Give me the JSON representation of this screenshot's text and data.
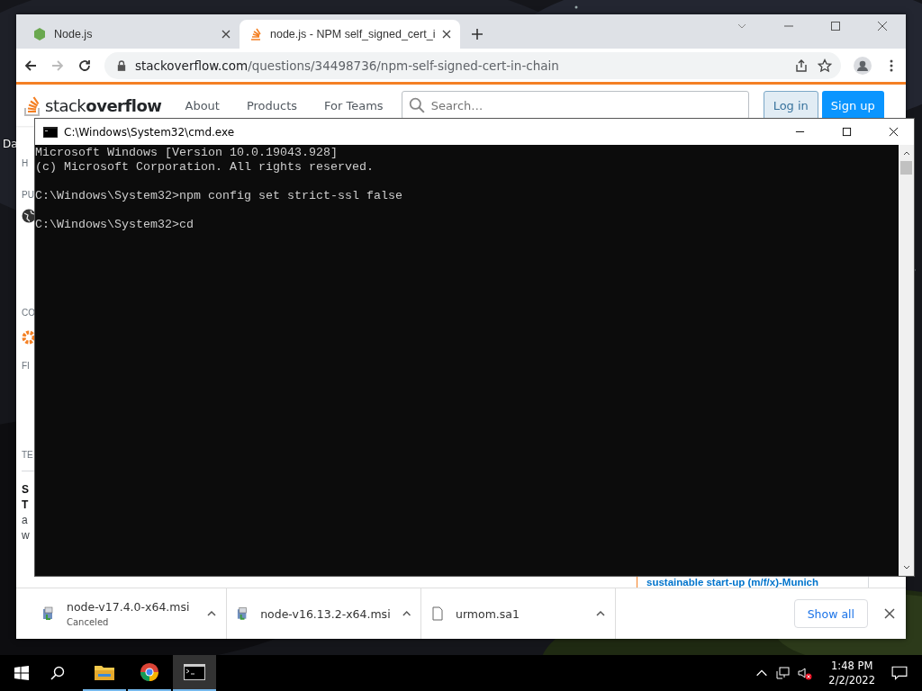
{
  "desktop": {
    "icon_label": "Da"
  },
  "browser": {
    "tabs": [
      {
        "title": "Node.js",
        "selected": false
      },
      {
        "title": "node.js - NPM self_signed_cert_i",
        "selected": true
      }
    ],
    "url_host": "stackoverflow.com",
    "url_path": "/questions/34498736/npm-self-signed-cert-in-chain",
    "page": {
      "logo": "stack**overflow**",
      "nav": [
        "About",
        "Products",
        "For Teams"
      ],
      "search_placeholder": "Search…",
      "login": "Log in",
      "signup": "Sign up",
      "sidebar_labels": [
        "H",
        "PU",
        "CO",
        "FI",
        "TE"
      ],
      "card_lines": [
        "S",
        "T",
        "a",
        "w"
      ],
      "ad_title": "sustainable start-up (m/f/x)-Munich"
    },
    "downloads": [
      {
        "name": "node-v17.4.0-x64.msi",
        "status": "Canceled",
        "kind": "installer"
      },
      {
        "name": "node-v16.13.2-x64.msi",
        "kind": "installer"
      },
      {
        "name": "urmom.sa1",
        "kind": "file"
      }
    ],
    "show_all": "Show all"
  },
  "console": {
    "title": "C:\\Windows\\System32\\cmd.exe",
    "blocks": [
      [
        "Microsoft Windows [Version 10.0.19043.928]",
        "(c) Microsoft Corporation. All rights reserved."
      ],
      [
        "C:\\Windows\\System32>npm config set strict-ssl false"
      ],
      [
        "C:\\Windows\\System32>cd"
      ]
    ]
  },
  "taskbar": {
    "apps": [
      {
        "kind": "explorer",
        "selected": false
      },
      {
        "kind": "chrome",
        "selected": false
      },
      {
        "kind": "console",
        "selected": true
      }
    ],
    "time": "1:48 PM",
    "date": "2/2/2022"
  }
}
